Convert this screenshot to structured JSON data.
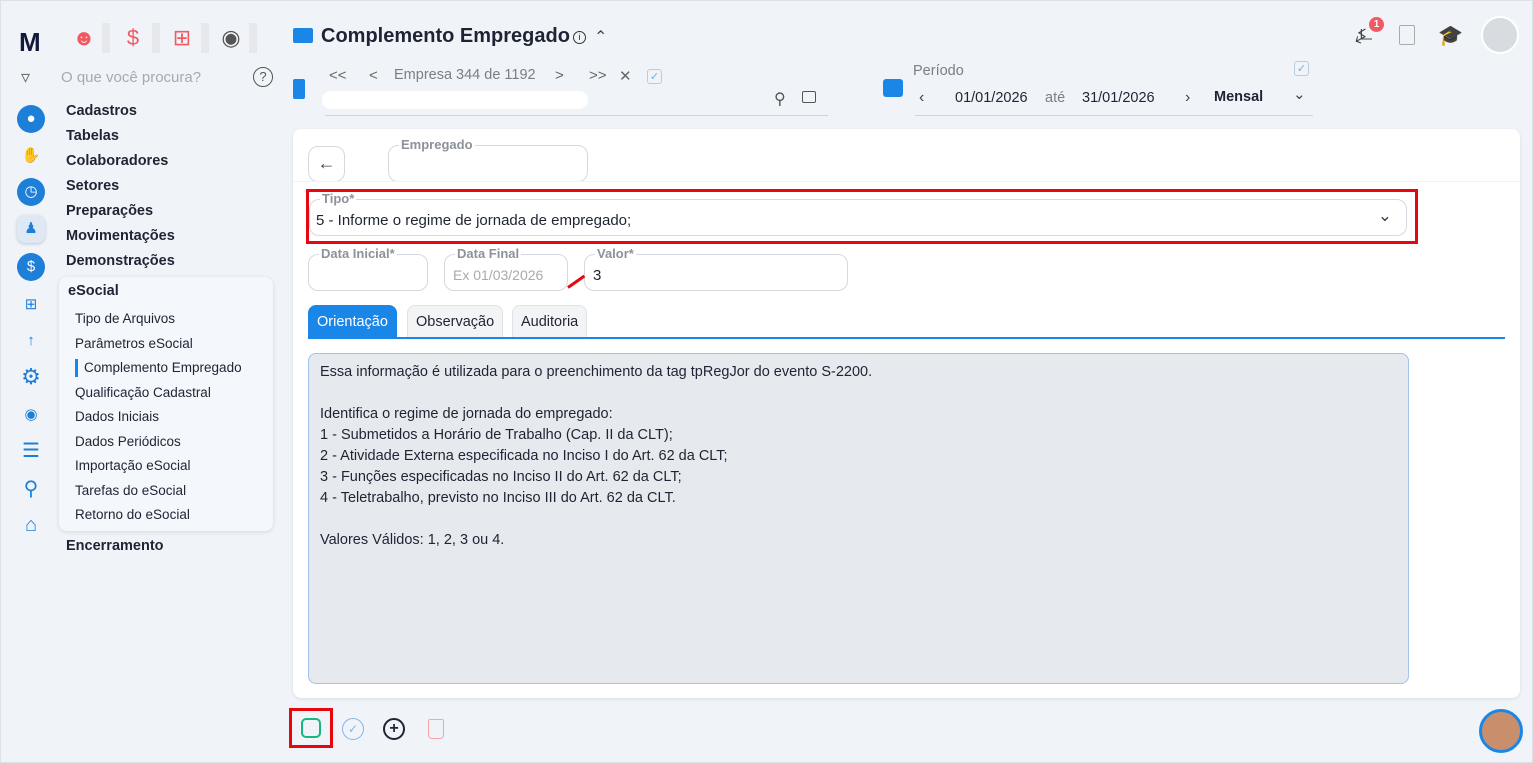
{
  "app": {
    "logo": "M",
    "title": "Complemento Empregado",
    "search_placeholder": "O que você procura?",
    "notification_count": "1"
  },
  "top_icons": [
    "people-icon",
    "dollar-icon",
    "calculator-icon",
    "money-bag-icon"
  ],
  "menu": [
    "Cadastros",
    "Tabelas",
    "Colaboradores",
    "Setores",
    "Preparações",
    "Movimentações",
    "Demonstrações"
  ],
  "esocial": {
    "title": "eSocial",
    "items": [
      "Tipo de Arquivos",
      "Parâmetros eSocial",
      "Complemento Empregado",
      "Qualificação Cadastral",
      "Dados Iniciais",
      "Dados Periódicos",
      "Importação eSocial",
      "Tarefas do eSocial",
      "Retorno do eSocial"
    ],
    "active": "Complemento Empregado"
  },
  "menu_after": "Encerramento",
  "empresa": {
    "first": "<<",
    "prev": "<",
    "label": "Empresa 344 de 1192",
    "next": ">",
    "last": ">>",
    "clear": "✕",
    "value": ""
  },
  "periodo": {
    "label": "Período",
    "start": "01/01/2026",
    "sep": "até",
    "end": "31/01/2026",
    "mode": "Mensal"
  },
  "form": {
    "empregado": {
      "label": "Empregado",
      "value": ""
    },
    "tipo": {
      "label": "Tipo*",
      "value": "5 - Informe o regime de jornada de empregado;"
    },
    "data_inicial": {
      "label": "Data Inicial*",
      "value": ""
    },
    "data_final": {
      "label": "Data Final",
      "placeholder": "Ex 01/03/2026"
    },
    "valor": {
      "label": "Valor*",
      "value": "3"
    }
  },
  "tabs": [
    "Orientação",
    "Observação",
    "Auditoria"
  ],
  "orientacao": "Essa informação é utilizada para o preenchimento da tag tpRegJor do evento S-2200.\n\nIdentifica o regime de jornada do empregado:\n1 - Submetidos a Horário de Trabalho (Cap. II da CLT);\n2 - Atividade Externa especificada no Inciso I do Art. 62 da CLT;\n3 - Funções especificadas no Inciso II do Art. 62 da CLT;\n4 - Teletrabalho, previsto no Inciso III do Art. 62 da CLT.\n\nValores Válidos: 1, 2, 3 ou 4.",
  "colors": {
    "accent": "#1a86e8",
    "annotation": "#e8070e",
    "save": "#16b87e"
  }
}
